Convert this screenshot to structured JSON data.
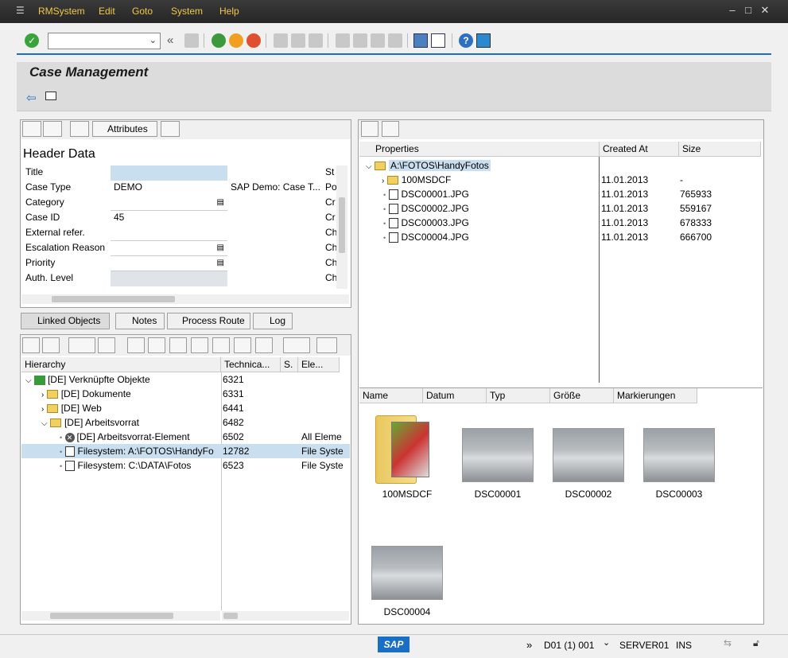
{
  "menu": [
    "RMSystem",
    "Edit",
    "Goto",
    "System",
    "Help"
  ],
  "title": "Case Management",
  "left_toolbar": {
    "attributes_label": "Attributes"
  },
  "header": {
    "heading": "Header Data",
    "fields": [
      {
        "label": "Title",
        "value": "",
        "extra": ""
      },
      {
        "label": "Case Type",
        "value": "DEMO",
        "extra": "SAP Demo: Case T..."
      },
      {
        "label": "Category",
        "value": "",
        "extra": ""
      },
      {
        "label": "Case ID",
        "value": "45",
        "extra": ""
      },
      {
        "label": "External refer.",
        "value": "",
        "extra": ""
      },
      {
        "label": "Escalation Reason",
        "value": "",
        "extra": ""
      },
      {
        "label": "Priority",
        "value": "",
        "extra": ""
      },
      {
        "label": "Auth. Level",
        "value": "",
        "extra": ""
      }
    ],
    "right_col": [
      "St",
      "Po",
      "Cr",
      "Cr",
      "Ch",
      "Ch",
      "Ch",
      "Ch"
    ]
  },
  "tabs": [
    "Linked Objects",
    "Notes",
    "Process Route",
    "Log"
  ],
  "hierarchy": {
    "columns": [
      "Hierarchy",
      "Technica...",
      "S.",
      "Ele..."
    ],
    "rows": [
      {
        "label": "[DE] Verknüpfte Objekte",
        "tech": "6321",
        "elem": ""
      },
      {
        "label": "[DE] Dokumente",
        "tech": "6331",
        "elem": ""
      },
      {
        "label": "[DE] Web",
        "tech": "6441",
        "elem": ""
      },
      {
        "label": "[DE] Arbeitsvorrat",
        "tech": "6482",
        "elem": ""
      },
      {
        "label": "[DE] Arbeitsvorrat-Element",
        "tech": "6502",
        "elem": "All Eleme"
      },
      {
        "label": "Filesystem: A:\\FOTOS\\HandyFo",
        "tech": "12782",
        "elem": "File Syste"
      },
      {
        "label": "Filesystem: C:\\DATA\\Fotos",
        "tech": "6523",
        "elem": "File Syste"
      }
    ]
  },
  "properties": {
    "columns": [
      "Properties",
      "Created At",
      "Size"
    ],
    "root": "A:\\FOTOS\\HandyFotos",
    "rows": [
      {
        "name": "100MSDCF",
        "created": "11.01.2013",
        "size": "-"
      },
      {
        "name": "DSC00001.JPG",
        "created": "11.01.2013",
        "size": "765933"
      },
      {
        "name": "DSC00002.JPG",
        "created": "11.01.2013",
        "size": "559167"
      },
      {
        "name": "DSC00003.JPG",
        "created": "11.01.2013",
        "size": "678333"
      },
      {
        "name": "DSC00004.JPG",
        "created": "11.01.2013",
        "size": "666700"
      }
    ]
  },
  "explorer": {
    "columns": [
      "Name",
      "Datum",
      "Typ",
      "Größe",
      "Markierungen"
    ],
    "items": [
      "100MSDCF",
      "DSC00001",
      "DSC00002",
      "DSC00003",
      "DSC00004"
    ]
  },
  "status": {
    "system": "D01 (1) 001",
    "server": "SERVER01",
    "mode": "INS",
    "logo": "SAP"
  }
}
